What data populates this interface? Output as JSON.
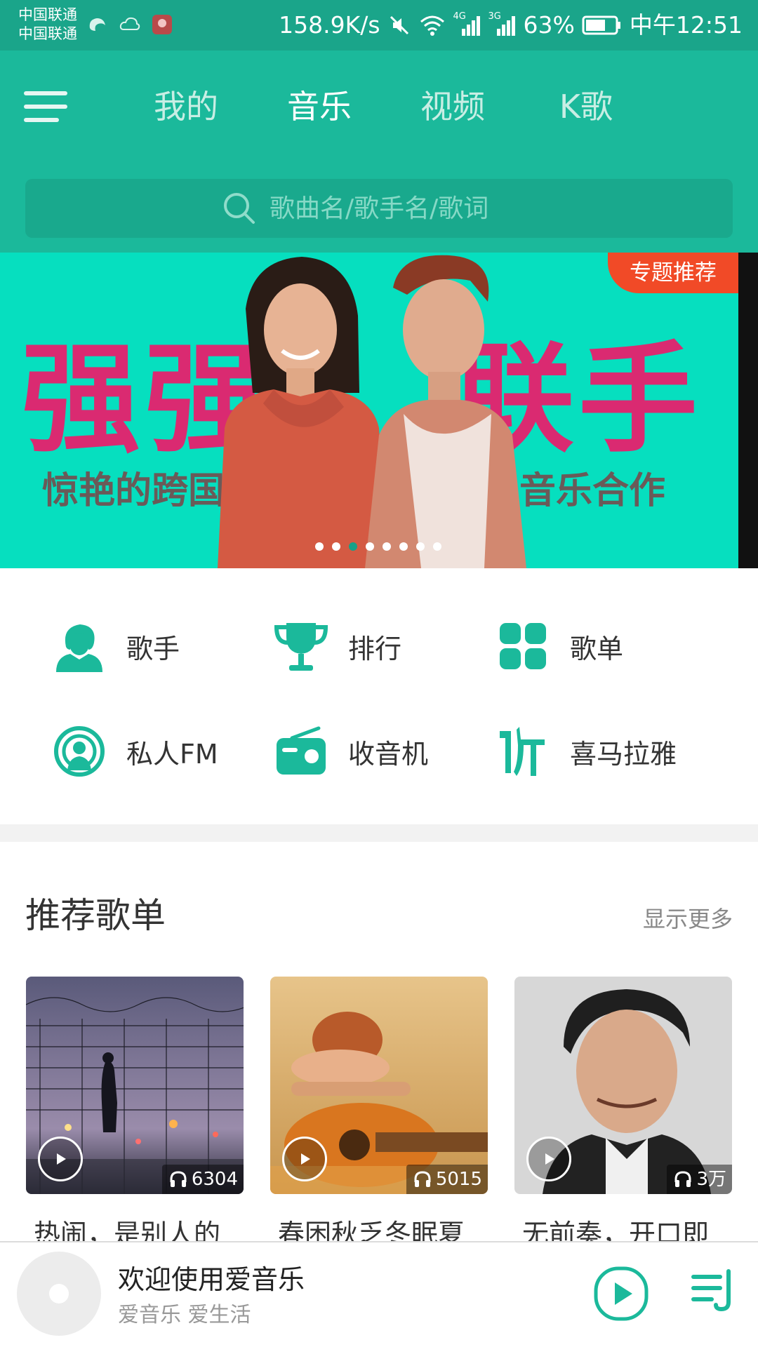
{
  "status_bar": {
    "carrier_1": "中国联通",
    "carrier_2": "中国联通",
    "speed": "158.9K/s",
    "network_1": "4G",
    "network_2": "3G",
    "battery": "63%",
    "time": "中午12:51"
  },
  "header": {
    "tabs": [
      {
        "label": "我的",
        "active": false
      },
      {
        "label": "音乐",
        "active": true
      },
      {
        "label": "视频",
        "active": false
      },
      {
        "label": "K歌",
        "active": false
      }
    ],
    "search_placeholder": "歌曲名/歌手名/歌词"
  },
  "banner": {
    "tag": "专题推荐",
    "headline_left": "强强",
    "headline_right": "联手",
    "subtitle_left": "惊艳的跨国",
    "subtitle_right": "音乐合作",
    "dot_count": 8,
    "active_dot": 2
  },
  "categories": [
    {
      "label": "歌手",
      "icon": "singer-icon"
    },
    {
      "label": "排行",
      "icon": "trophy-icon"
    },
    {
      "label": "歌单",
      "icon": "playlist-grid-icon"
    },
    {
      "label": "私人FM",
      "icon": "radio-fm-icon"
    },
    {
      "label": "收音机",
      "icon": "radio-icon"
    },
    {
      "label": "喜马拉雅",
      "icon": "ximalaya-icon"
    }
  ],
  "recommended": {
    "title": "推荐歌单",
    "more": "显示更多",
    "playlists": [
      {
        "title": "热闹，是别人的",
        "plays": "6304"
      },
      {
        "title": "春困秋乏冬眠夏",
        "plays": "5015"
      },
      {
        "title": "无前奏，开口即",
        "plays": "3万"
      }
    ]
  },
  "player": {
    "title": "欢迎使用爱音乐",
    "subtitle": "爱音乐  爱生活"
  },
  "colors": {
    "primary": "#1bb99b",
    "status_bar": "#1aa58a",
    "banner_bg": "#06dfbf",
    "banner_headline": "#da2a71",
    "tag_bg": "#f14a27",
    "icon": "#1bb99b"
  }
}
